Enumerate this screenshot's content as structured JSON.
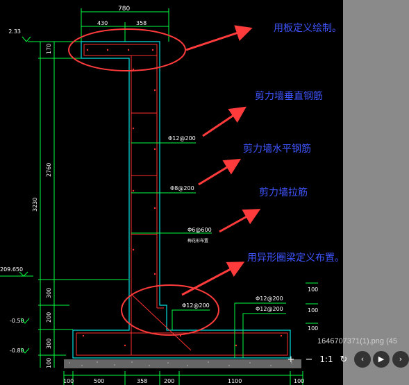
{
  "drawing": {
    "dim_top_total": "780",
    "dim_top_left": "430",
    "dim_top_right": "358",
    "elev_top": "2.33",
    "elev_mid": "209.650",
    "elev_neg1": "-0.50",
    "elev_neg2": "-0.80",
    "dim_170": "170",
    "dim_2760": "2760",
    "dim_3230": "3230",
    "dim_300a": "300",
    "dim_200": "200",
    "dim_300b": "300",
    "dim_100": "100",
    "bottom_dims": [
      "100",
      "500",
      "358",
      "200",
      "1100",
      "100"
    ],
    "rebar_vertical": "Φ12@200",
    "rebar_horizontal": "Φ8@200",
    "rebar_tie": "Φ6@600",
    "rebar_tie_note": "梅花形布置",
    "rebar_ring": "Φ12@200",
    "rebar_r1": "Φ12@200",
    "rebar_r2": "Φ12@200",
    "side_dim1": "100",
    "side_dim2": "100",
    "side_dim3": "100"
  },
  "annotations": {
    "slab": "用板定义绘制。",
    "wall_vertical": "剪力墙垂直钢筋",
    "wall_horizontal": "剪力墙水平钢筋",
    "wall_tie": "剪力墙拉筋",
    "ring_beam": "用异形圈梁定义布置。"
  },
  "viewer": {
    "filename": "1646707371(1).png (45",
    "zoom_in": "+",
    "zoom_out": "−",
    "actual_size": "1:1",
    "rotate": "↻",
    "prev": "‹",
    "play": "▶",
    "next": "›"
  },
  "colors": {
    "annotation_arrow": "#ff3b3b",
    "annotation_text": "#3f55ff",
    "concrete_outline": "#00e0e0",
    "rebar": "#ff3030",
    "dimension": "#00ff40",
    "background": "#000000"
  }
}
